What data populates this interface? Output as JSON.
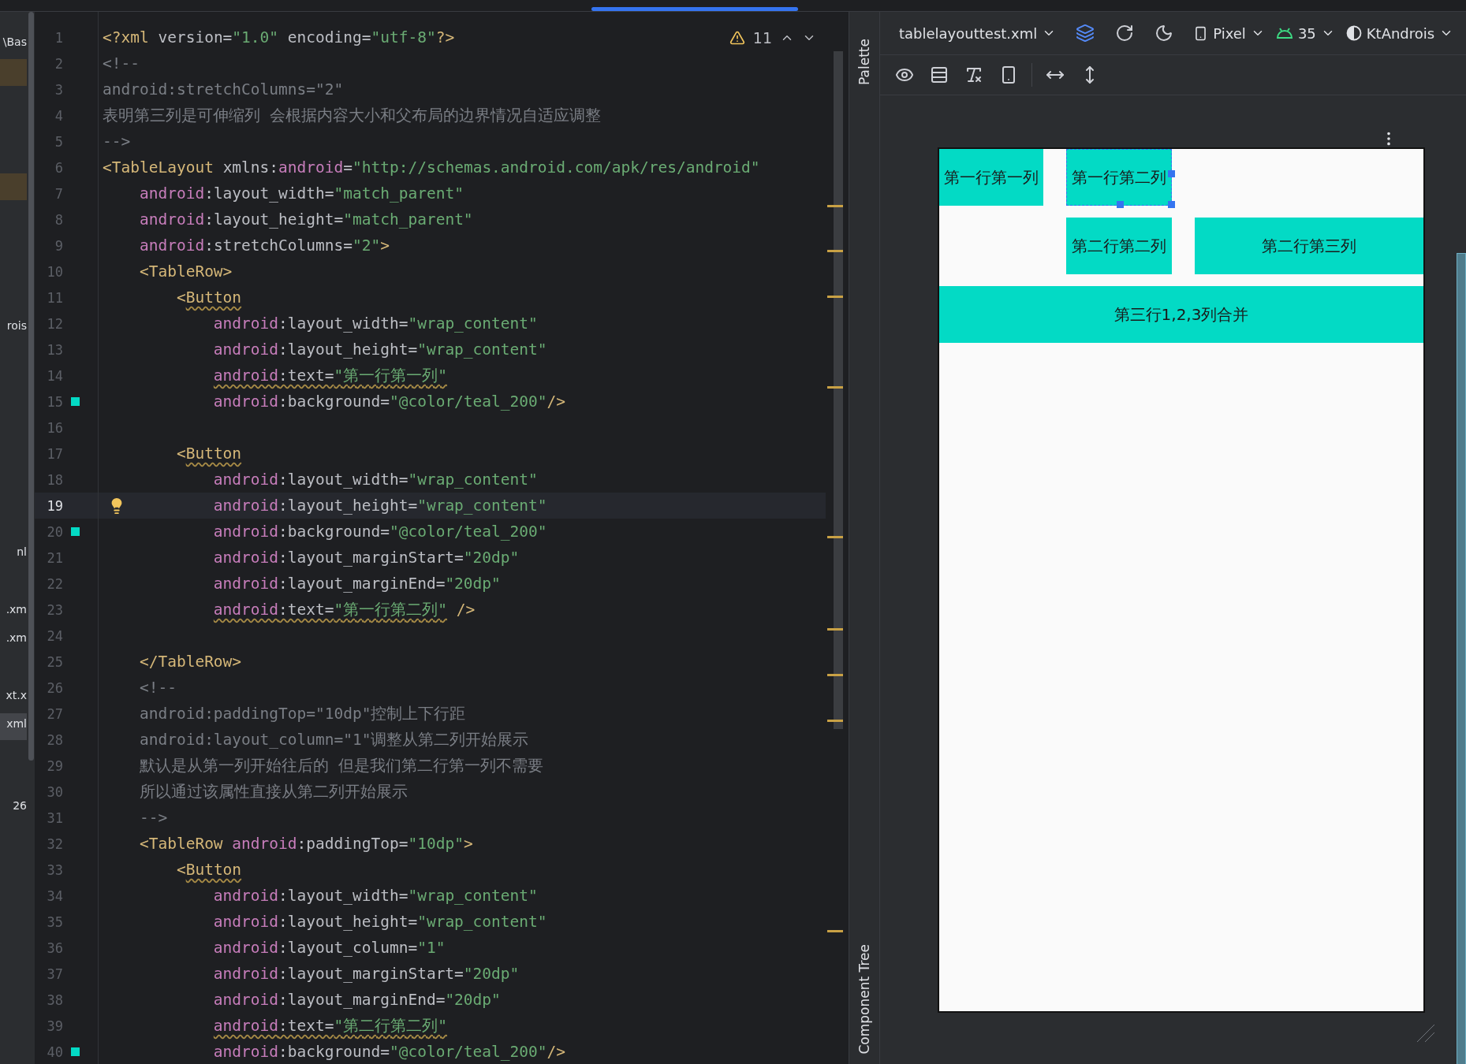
{
  "project_tree": {
    "fragments": [
      "\\Bas",
      "rois",
      "nl",
      ".xm",
      ".xm",
      "xt.x",
      "xml",
      "26"
    ]
  },
  "editor": {
    "warnings": "11",
    "lines": [
      {
        "n": "1",
        "current": false,
        "swatch": false,
        "tokens": [
          {
            "kind": "tag",
            "t": "<?xml"
          },
          {
            "kind": "plain",
            "t": " version="
          },
          {
            "kind": "str",
            "t": "\"1.0\""
          },
          {
            "kind": "plain",
            "t": " encoding="
          },
          {
            "kind": "str",
            "t": "\"utf-8\""
          },
          {
            "kind": "tag",
            "t": "?>"
          }
        ]
      },
      {
        "n": "2",
        "current": false,
        "swatch": false,
        "tokens": [
          {
            "kind": "comment",
            "t": "<!--"
          }
        ]
      },
      {
        "n": "3",
        "current": false,
        "swatch": false,
        "tokens": [
          {
            "kind": "comment",
            "t": "android:stretchColumns=\"2\""
          }
        ]
      },
      {
        "n": "4",
        "current": false,
        "swatch": false,
        "tokens": [
          {
            "kind": "comment",
            "t": "表明第三列是可伸缩列 会根据内容大小和父布局的边界情况自适应调整"
          }
        ]
      },
      {
        "n": "5",
        "current": false,
        "swatch": false,
        "tokens": [
          {
            "kind": "comment",
            "t": "-->"
          }
        ]
      },
      {
        "n": "6",
        "current": false,
        "swatch": false,
        "tokens": [
          {
            "kind": "tag",
            "t": "<TableLayout"
          },
          {
            "kind": "plain",
            "t": " xmlns:"
          },
          {
            "kind": "ns",
            "t": "android"
          },
          {
            "kind": "plain",
            "t": "="
          },
          {
            "kind": "str",
            "t": "\"http://schemas.android.com/apk/res/android\""
          }
        ]
      },
      {
        "n": "7",
        "current": false,
        "swatch": false,
        "tokens": [
          {
            "kind": "ns",
            "t": "    android"
          },
          {
            "kind": "plain",
            "t": ":layout_width="
          },
          {
            "kind": "str",
            "t": "\"match_parent\""
          }
        ]
      },
      {
        "n": "8",
        "current": false,
        "swatch": false,
        "tokens": [
          {
            "kind": "ns",
            "t": "    android"
          },
          {
            "kind": "plain",
            "t": ":layout_height="
          },
          {
            "kind": "str",
            "t": "\"match_parent\""
          }
        ]
      },
      {
        "n": "9",
        "current": false,
        "swatch": false,
        "tokens": [
          {
            "kind": "ns",
            "t": "    android"
          },
          {
            "kind": "plain",
            "t": ":stretchColumns="
          },
          {
            "kind": "str",
            "t": "\"2\""
          },
          {
            "kind": "tag",
            "t": ">"
          }
        ]
      },
      {
        "n": "10",
        "current": false,
        "swatch": false,
        "tokens": [
          {
            "kind": "tag",
            "t": "    <TableRow>"
          }
        ]
      },
      {
        "n": "11",
        "current": false,
        "swatch": false,
        "tokens": [
          {
            "kind": "tag",
            "t": "        <"
          },
          {
            "kind": "tag-warn",
            "t": "Button"
          }
        ]
      },
      {
        "n": "12",
        "current": false,
        "swatch": false,
        "tokens": [
          {
            "kind": "ns",
            "t": "            android"
          },
          {
            "kind": "plain",
            "t": ":layout_width="
          },
          {
            "kind": "str",
            "t": "\"wrap_content\""
          }
        ]
      },
      {
        "n": "13",
        "current": false,
        "swatch": false,
        "tokens": [
          {
            "kind": "ns",
            "t": "            android"
          },
          {
            "kind": "plain",
            "t": ":layout_height="
          },
          {
            "kind": "str",
            "t": "\"wrap_content\""
          }
        ]
      },
      {
        "n": "14",
        "current": false,
        "swatch": false,
        "tokens": [
          {
            "kind": "ns-warn",
            "t": "            android"
          },
          {
            "kind": "plain-warn",
            "t": ":text="
          },
          {
            "kind": "str-warn",
            "t": "\"第一行第一列\""
          }
        ]
      },
      {
        "n": "15",
        "current": false,
        "swatch": true,
        "tokens": [
          {
            "kind": "ns",
            "t": "            android"
          },
          {
            "kind": "plain",
            "t": ":background="
          },
          {
            "kind": "str",
            "t": "\"@color/teal_200\""
          },
          {
            "kind": "tag",
            "t": "/>"
          }
        ]
      },
      {
        "n": "16",
        "current": false,
        "swatch": false
      },
      {
        "n": "17",
        "current": false,
        "swatch": false,
        "tokens": [
          {
            "kind": "tag",
            "t": "        <"
          },
          {
            "kind": "tag-warn",
            "t": "Button"
          }
        ]
      },
      {
        "n": "18",
        "current": false,
        "swatch": false,
        "tokens": [
          {
            "kind": "ns",
            "t": "            android"
          },
          {
            "kind": "plain",
            "t": ":layout_width="
          },
          {
            "kind": "str",
            "t": "\"wrap_content\""
          }
        ]
      },
      {
        "n": "19",
        "current": true,
        "swatch": false,
        "tokens": [
          {
            "kind": "ns",
            "t": "            android"
          },
          {
            "kind": "plain",
            "t": ":layout_height="
          },
          {
            "kind": "str",
            "t": "\"wrap_content\""
          }
        ]
      },
      {
        "n": "20",
        "current": false,
        "swatch": true,
        "tokens": [
          {
            "kind": "ns",
            "t": "            android"
          },
          {
            "kind": "plain",
            "t": ":background="
          },
          {
            "kind": "str",
            "t": "\"@color/teal_200\""
          }
        ]
      },
      {
        "n": "21",
        "current": false,
        "swatch": false,
        "tokens": [
          {
            "kind": "ns",
            "t": "            android"
          },
          {
            "kind": "plain",
            "t": ":layout_marginStart="
          },
          {
            "kind": "str",
            "t": "\"20dp\""
          }
        ]
      },
      {
        "n": "22",
        "current": false,
        "swatch": false,
        "tokens": [
          {
            "kind": "ns",
            "t": "            android"
          },
          {
            "kind": "plain",
            "t": ":layout_marginEnd="
          },
          {
            "kind": "str",
            "t": "\"20dp\""
          }
        ]
      },
      {
        "n": "23",
        "current": false,
        "swatch": false,
        "tokens": [
          {
            "kind": "ns-warn",
            "t": "            android"
          },
          {
            "kind": "plain-warn",
            "t": ":text="
          },
          {
            "kind": "str-warn",
            "t": "\"第一行第二列\""
          },
          {
            "kind": "tag",
            "t": " />"
          }
        ]
      },
      {
        "n": "24",
        "current": false,
        "swatch": false
      },
      {
        "n": "25",
        "current": false,
        "swatch": false,
        "tokens": [
          {
            "kind": "tag",
            "t": "    </TableRow>"
          }
        ]
      },
      {
        "n": "26",
        "current": false,
        "swatch": false,
        "tokens": [
          {
            "kind": "comment",
            "t": "    <!--"
          }
        ]
      },
      {
        "n": "27",
        "current": false,
        "swatch": false,
        "tokens": [
          {
            "kind": "comment",
            "t": "    android:paddingTop=\"10dp\"控制上下行距"
          }
        ]
      },
      {
        "n": "28",
        "current": false,
        "swatch": false,
        "tokens": [
          {
            "kind": "comment",
            "t": "    android:layout_column=\"1\"调整从第二列开始展示"
          }
        ]
      },
      {
        "n": "29",
        "current": false,
        "swatch": false,
        "tokens": [
          {
            "kind": "comment",
            "t": "    默认是从第一列开始往后的 但是我们第二行第一列不需要"
          }
        ]
      },
      {
        "n": "30",
        "current": false,
        "swatch": false,
        "tokens": [
          {
            "kind": "comment",
            "t": "    所以通过该属性直接从第二列开始展示"
          }
        ]
      },
      {
        "n": "31",
        "current": false,
        "swatch": false,
        "tokens": [
          {
            "kind": "comment",
            "t": "    -->"
          }
        ]
      },
      {
        "n": "32",
        "current": false,
        "swatch": false,
        "tokens": [
          {
            "kind": "tag",
            "t": "    <TableRow"
          },
          {
            "kind": "ns",
            "t": " android"
          },
          {
            "kind": "plain",
            "t": ":paddingTop="
          },
          {
            "kind": "str",
            "t": "\"10dp\""
          },
          {
            "kind": "tag",
            "t": ">"
          }
        ]
      },
      {
        "n": "33",
        "current": false,
        "swatch": false,
        "tokens": [
          {
            "kind": "tag",
            "t": "        <"
          },
          {
            "kind": "tag-warn",
            "t": "Button"
          }
        ]
      },
      {
        "n": "34",
        "current": false,
        "swatch": false,
        "tokens": [
          {
            "kind": "ns",
            "t": "            android"
          },
          {
            "kind": "plain",
            "t": ":layout_width="
          },
          {
            "kind": "str",
            "t": "\"wrap_content\""
          }
        ]
      },
      {
        "n": "35",
        "current": false,
        "swatch": false,
        "tokens": [
          {
            "kind": "ns",
            "t": "            android"
          },
          {
            "kind": "plain",
            "t": ":layout_height="
          },
          {
            "kind": "str",
            "t": "\"wrap_content\""
          }
        ]
      },
      {
        "n": "36",
        "current": false,
        "swatch": false,
        "tokens": [
          {
            "kind": "ns",
            "t": "            android"
          },
          {
            "kind": "plain",
            "t": ":layout_column="
          },
          {
            "kind": "str",
            "t": "\"1\""
          }
        ]
      },
      {
        "n": "37",
        "current": false,
        "swatch": false,
        "tokens": [
          {
            "kind": "ns",
            "t": "            android"
          },
          {
            "kind": "plain",
            "t": ":layout_marginStart="
          },
          {
            "kind": "str",
            "t": "\"20dp\""
          }
        ]
      },
      {
        "n": "38",
        "current": false,
        "swatch": false,
        "tokens": [
          {
            "kind": "ns",
            "t": "            android"
          },
          {
            "kind": "plain",
            "t": ":layout_marginEnd="
          },
          {
            "kind": "str",
            "t": "\"20dp\""
          }
        ]
      },
      {
        "n": "39",
        "current": false,
        "swatch": false,
        "tokens": [
          {
            "kind": "ns-warn",
            "t": "            android"
          },
          {
            "kind": "plain-warn",
            "t": ":text="
          },
          {
            "kind": "str-warn",
            "t": "\"第二行第二列\""
          }
        ]
      },
      {
        "n": "40",
        "current": false,
        "swatch": true,
        "tokens": [
          {
            "kind": "ns",
            "t": "            android"
          },
          {
            "kind": "plain",
            "t": ":background="
          },
          {
            "kind": "str",
            "t": "\"@color/teal_200\""
          },
          {
            "kind": "tag",
            "t": "/>"
          }
        ]
      }
    ]
  },
  "side_tabs": [
    "Palette",
    "Component Tree"
  ],
  "design": {
    "file": "tablelayouttest.xml",
    "device": "Pixel",
    "api": "35",
    "theme": "KtAndrois",
    "preview": {
      "rows": [
        {
          "cells": [
            {
              "kind": "first",
              "text": "第一行第一列",
              "selected": false
            },
            {
              "kind": "second",
              "text": "第一行第二列",
              "selected": true
            }
          ]
        },
        {
          "cells": [
            {
              "kind": "second",
              "text": "第二行第二列",
              "selected": false
            },
            {
              "kind": "third",
              "text": "第二行第三列",
              "selected": false
            }
          ]
        },
        {
          "cells": [
            {
              "kind": "merged",
              "text": "第三行1,2,3列合并",
              "selected": false
            }
          ]
        }
      ]
    }
  }
}
